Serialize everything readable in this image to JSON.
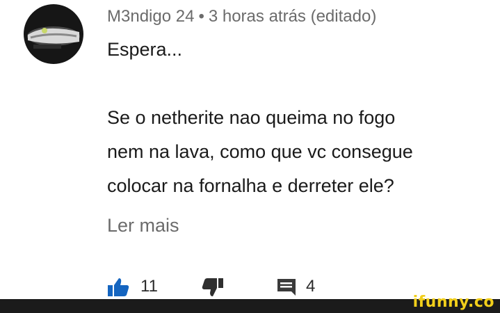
{
  "comment": {
    "author": "M3ndigo 24",
    "separator": "•",
    "meta": "3 horas atrás (editado)",
    "lines": [
      "Espera...",
      "Se o netherite nao queima no fogo",
      "nem na lava, como que vc consegue",
      "colocar na fornalha e derreter ele?"
    ],
    "read_more": "Ler mais",
    "likes": "11",
    "replies": "4"
  },
  "icons": {
    "like": "thumbs-up-icon",
    "dislike": "thumbs-down-icon",
    "reply": "comment-icon",
    "avatar": "avatar-image"
  },
  "colors": {
    "text": "#1a1a1a",
    "meta": "#6b6b6b",
    "like_active": "#1565c0",
    "watermark": "#f2cf1b"
  },
  "watermark": "ifunny.co"
}
